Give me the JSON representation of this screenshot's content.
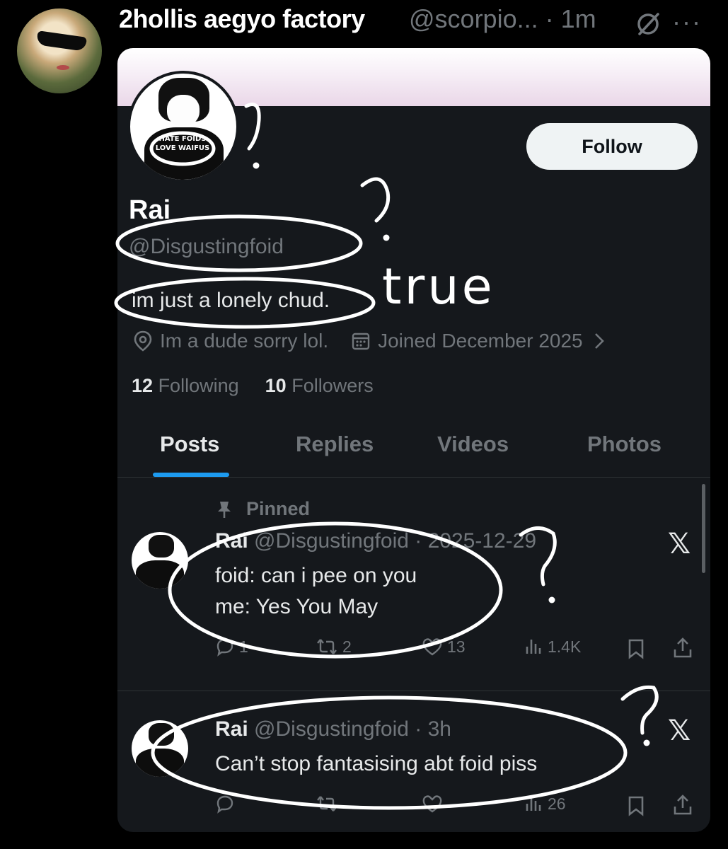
{
  "tweet": {
    "author_name": "2hollis aegyo factory",
    "author_handle_time": "@scorpio... · 1m"
  },
  "profile": {
    "follow_label": "Follow",
    "name": "Rai",
    "handle": "@Disgustingfoid",
    "bio": "im just a lonely chud.",
    "location": "Im a dude sorry lol.",
    "joined": "Joined December 2025",
    "following_count": "12",
    "following_label": "Following",
    "followers_count": "10",
    "followers_label": "Followers",
    "pfp_shirt_text": "HATE FOIDS LOVE WAIFUS"
  },
  "tabs": [
    {
      "label": "Posts",
      "active": true
    },
    {
      "label": "Replies",
      "active": false
    },
    {
      "label": "Videos",
      "active": false
    },
    {
      "label": "Photos",
      "active": false
    }
  ],
  "posts": [
    {
      "pinned_label": "Pinned",
      "name": "Rai",
      "handle_date": "@Disgustingfoid · 2025-12-29",
      "lines": [
        "foid: can i pee on you",
        "me: Yes You May"
      ],
      "replies": "1",
      "reposts": "2",
      "likes": "13",
      "views": "1.4K"
    },
    {
      "name": "Rai",
      "handle_date": "@Disgustingfoid · 3h",
      "lines": [
        "Can’t stop fantasising abt foid piss"
      ],
      "views": "26"
    }
  ],
  "annotations": {
    "handwritten_word": "true",
    "question_mark": "?"
  },
  "colors": {
    "background": "#000000",
    "card": "#15181c",
    "accent": "#1d9bf0",
    "muted": "#71767b",
    "text": "#e7e9ea"
  }
}
